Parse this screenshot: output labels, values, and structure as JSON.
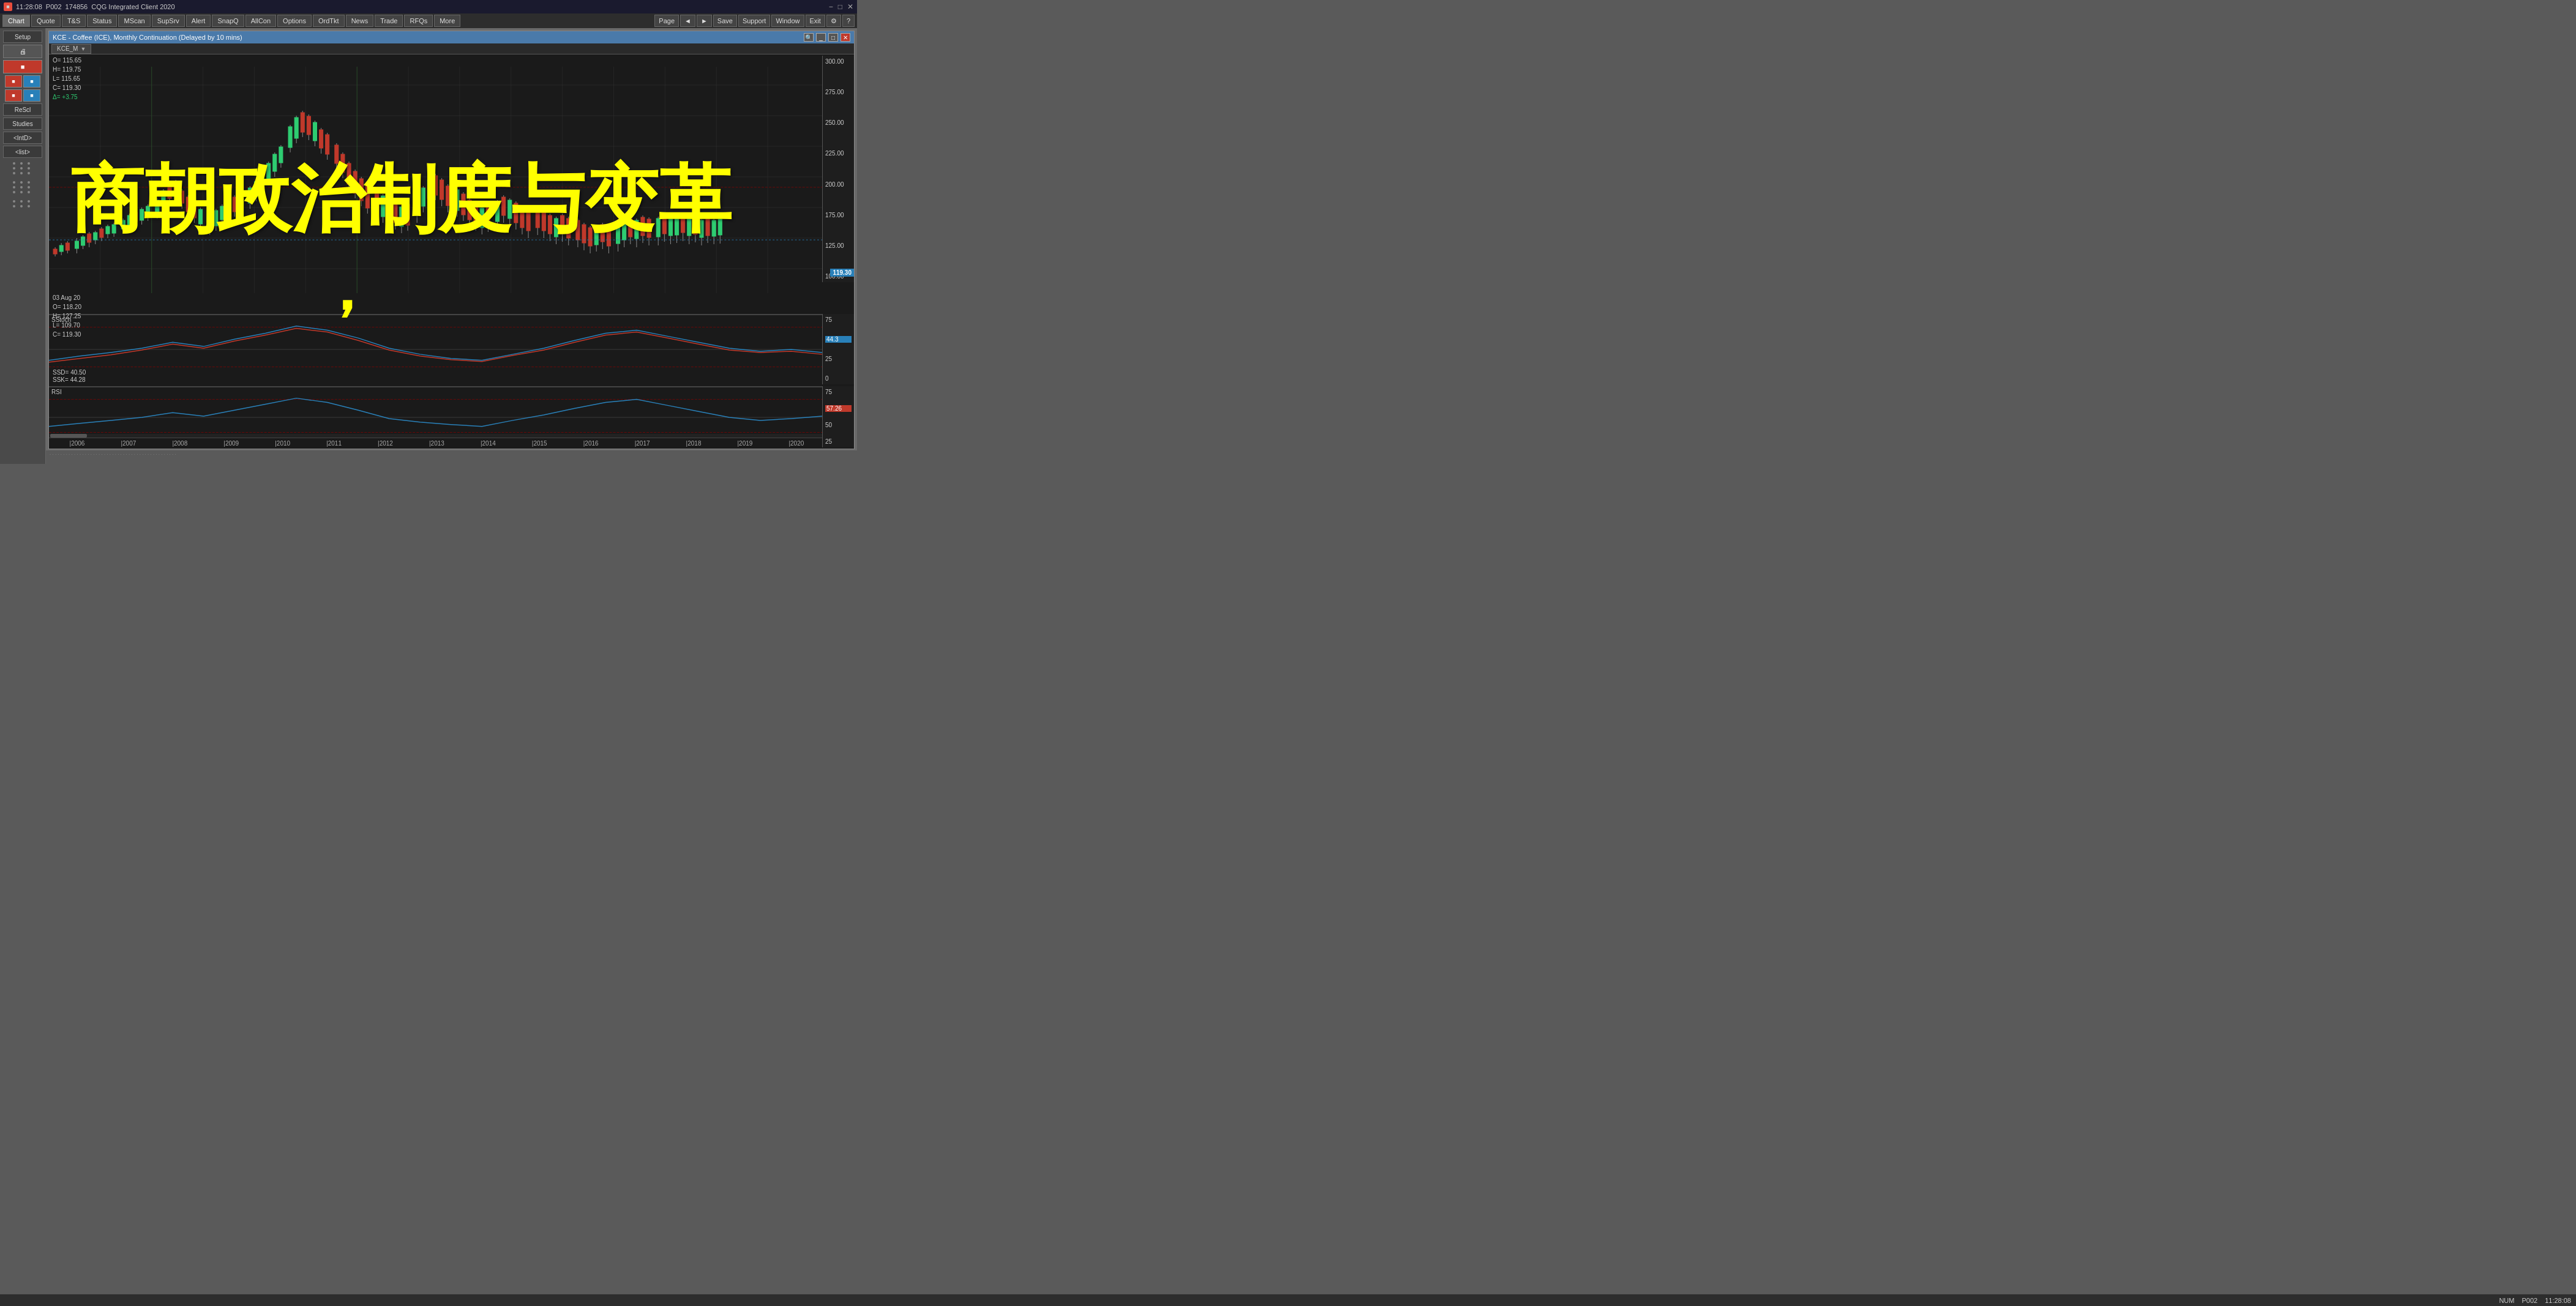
{
  "titleBar": {
    "time": "11:28:08",
    "pageId": "P002",
    "accountId": "174856",
    "appName": "CQG Integrated Client 2020",
    "minBtn": "−",
    "maxBtn": "□",
    "closeBtn": "✕"
  },
  "menuBar": {
    "items": [
      "Chart",
      "Quote",
      "T&S",
      "Status",
      "MScan",
      "SupSrv",
      "Alert",
      "SnapQ",
      "AllCon",
      "Options",
      "OrdTkt",
      "News",
      "Trade",
      "RFQs",
      "More"
    ],
    "rightItems": [
      "Page",
      "◄",
      "►",
      "Save",
      "Support",
      "Window",
      "Exit",
      "?"
    ]
  },
  "sidebar": {
    "setupLabel": "Setup",
    "rescaleLabel": "ReScl",
    "studiesLabel": "Studies",
    "intdLabel": "<IntD>",
    "listLabel": "<list>"
  },
  "chartWindow": {
    "title": "KCE - Coffee (ICE), Monthly Continuation (Delayed by 10 mins)",
    "tabLabel": "KCE_M",
    "ohlc": {
      "open": "O=  115.65",
      "high": "H=  119.75",
      "low": "L=  115.65",
      "close": "C=  119.30",
      "delta": "Δ=  +3.75"
    },
    "barInfo": {
      "date": "03 Aug 20",
      "open": "O=  118.20",
      "high": "H=  127.25",
      "low": "L=  109.70",
      "close": "C=  119.30"
    },
    "priceAxis": {
      "labels": [
        "300.00",
        "275.00",
        "250.00",
        "225.00",
        "200.00",
        "175.00",
        "125.00",
        "100.00"
      ]
    },
    "currentPrice": "119.30",
    "stoch": {
      "label": "SStoch",
      "ssk": "SSK=  44.28",
      "ssd": "SSD=  40.50",
      "currentValue": "44.3",
      "axisLabels": [
        "75",
        "50",
        "25",
        "0"
      ]
    },
    "rsi": {
      "label": "RSI",
      "value": "RSI=  57.26",
      "currentValue": "57.26",
      "axisLabels": [
        "75",
        "50",
        "25"
      ]
    },
    "dateAxis": {
      "labels": [
        "|2006",
        "|2007",
        "|2008",
        "|2009",
        "|2010",
        "|2011",
        "|2012",
        "|2013",
        "|2014",
        "|2015",
        "|2016",
        "|2017",
        "|2018",
        "|2019",
        "|2020"
      ]
    }
  },
  "overlayText": {
    "chinese": "商朝政治制度与变革",
    "comma": "，"
  },
  "statusBar": {
    "numLabel": "NUM",
    "pageLabel": "P002",
    "time": "11:28:08"
  }
}
